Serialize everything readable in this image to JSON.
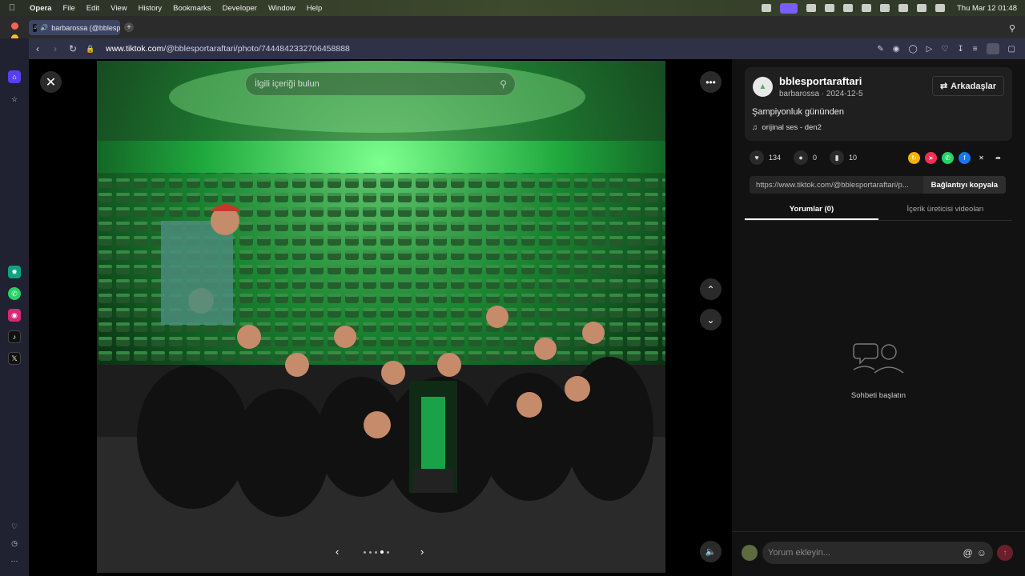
{
  "menubar": {
    "app": "Opera",
    "items": [
      "File",
      "Edit",
      "View",
      "History",
      "Bookmarks",
      "Developer",
      "Window",
      "Help"
    ],
    "clock": "Thu Mar 12  01:48"
  },
  "browser": {
    "tab_title": "barbarossa (@bblesp",
    "url_host": "www.tiktok.com",
    "url_path": "/@bblesportaraftari/photo/7444842332706458888"
  },
  "viewer": {
    "search_placeholder": "İlgili içeriği bulun",
    "slide_count": 5,
    "active_slide": 4
  },
  "post": {
    "username": "bblesportaraftari",
    "author": "barbarossa",
    "date": "2024-12-5",
    "meta": "barbarossa · 2024-12-5",
    "friends_label": "Arkadaşlar",
    "description": "Şampiyonluk gününden",
    "music": "orijinal ses - den2",
    "likes": "134",
    "comments": "0",
    "saves": "10",
    "share_link": "https://www.tiktok.com/@bblesportaraftari/p...",
    "copy_label": "Bağlantıyı kopyala",
    "tab_comments": "Yorumlar (0)",
    "tab_creator": "İçerik üreticisi videoları",
    "empty_text": "Sohbeti başlatın",
    "comment_placeholder": "Yorum ekleyin..."
  },
  "colors": {
    "accent_green": "#1fd660",
    "opera_accent": "#7a5cff",
    "send_button": "#6a1f2c"
  }
}
